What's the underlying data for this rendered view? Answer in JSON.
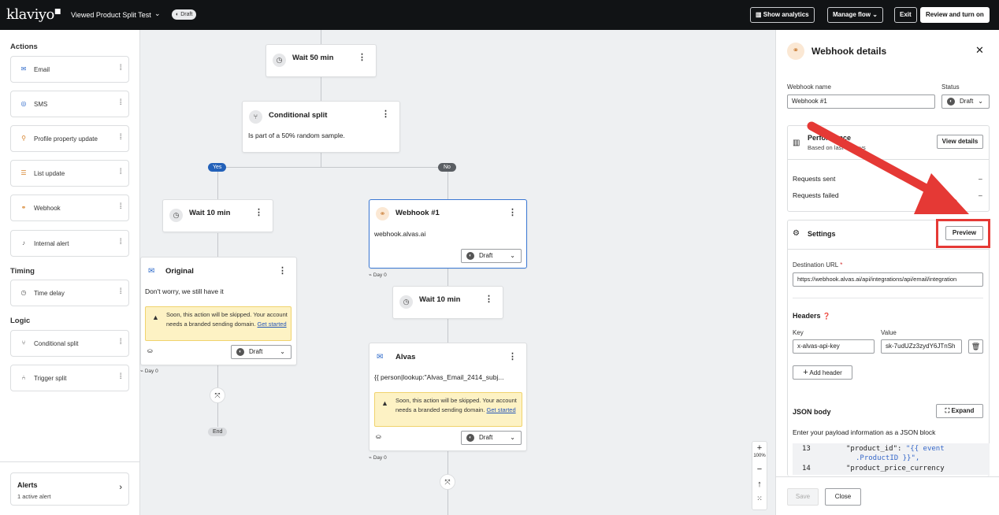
{
  "topbar": {
    "logo": "klaviyo",
    "flow_name": "Viewed Product Split Test",
    "status": "Draft",
    "show_analytics": "Show analytics",
    "manage_flow": "Manage flow",
    "exit": "Exit",
    "review": "Review and turn on"
  },
  "sidebar": {
    "actions_title": "Actions",
    "actions": [
      {
        "label": "Email",
        "icon": "mail-icon"
      },
      {
        "label": "SMS",
        "icon": "sms-icon"
      },
      {
        "label": "Profile property update",
        "icon": "profile-icon"
      },
      {
        "label": "List update",
        "icon": "list-icon"
      },
      {
        "label": "Webhook",
        "icon": "webhook-icon"
      },
      {
        "label": "Internal alert",
        "icon": "bell-icon"
      }
    ],
    "timing_title": "Timing",
    "timing": [
      {
        "label": "Time delay",
        "icon": "clock-icon"
      }
    ],
    "logic_title": "Logic",
    "logic": [
      {
        "label": "Conditional split",
        "icon": "split-icon"
      },
      {
        "label": "Trigger split",
        "icon": "trigger-split-icon"
      }
    ],
    "alerts_title": "Alerts",
    "alerts_sub": "1 active alert"
  },
  "canvas": {
    "wait1": "Wait 50 min",
    "split_title": "Conditional split",
    "split_text": "Is part of a 50% random sample.",
    "yes": "Yes",
    "no": "No",
    "wait2": "Wait 10 min",
    "original_title": "Original",
    "original_text": "Don't worry, we still have it",
    "warn_text": "Soon, this action will be skipped. Your account needs a branded sending domain.",
    "warn_link": "Get started",
    "draft": "Draft",
    "day0": "Day 0",
    "end": "End",
    "webhook_title": "Webhook #1",
    "webhook_text": "webhook.alvas.ai",
    "wait3": "Wait 10 min",
    "alvas_title": "Alvas",
    "alvas_text": "{{ person|lookup:\"Alvas_Email_2414_subj...",
    "zoom": "100%"
  },
  "panel": {
    "title": "Webhook details",
    "name_label": "Webhook name",
    "name_value": "Webhook #1",
    "status_label": "Status",
    "status_value": "Draft",
    "perf_title": "Performance",
    "perf_sub": "Based on last 30 days",
    "view_details": "View details",
    "requests_sent": "Requests sent",
    "requests_failed": "Requests failed",
    "dash": "–",
    "settings": "Settings",
    "preview": "Preview",
    "dest_label": "Destination URL",
    "dest_value": "https://webhook.alvas.ai/api/integrations/api/email/integration",
    "headers": "Headers",
    "key_label": "Key",
    "value_label": "Value",
    "key_value": "x-alvas-api-key",
    "value_value": "sk-7udUZz3zydY6JTnSh",
    "add_header": "Add header",
    "json_title": "JSON body",
    "expand": "Expand",
    "json_desc": "Enter your payload information as a JSON block",
    "code_line1_no": "13",
    "code_line1_key": "\"product_id\": ",
    "code_line1_val": "\"{{ event",
    "code_line1b": ".ProductID }}\",",
    "code_line2_no": "14",
    "code_line2_key": "\"product_price_currency",
    "save": "Save",
    "close": "Close"
  },
  "colors": {
    "topbar": "#111315",
    "yes": "#2361b9",
    "annotation": "#e53935",
    "warning": "#fdf2c4"
  }
}
